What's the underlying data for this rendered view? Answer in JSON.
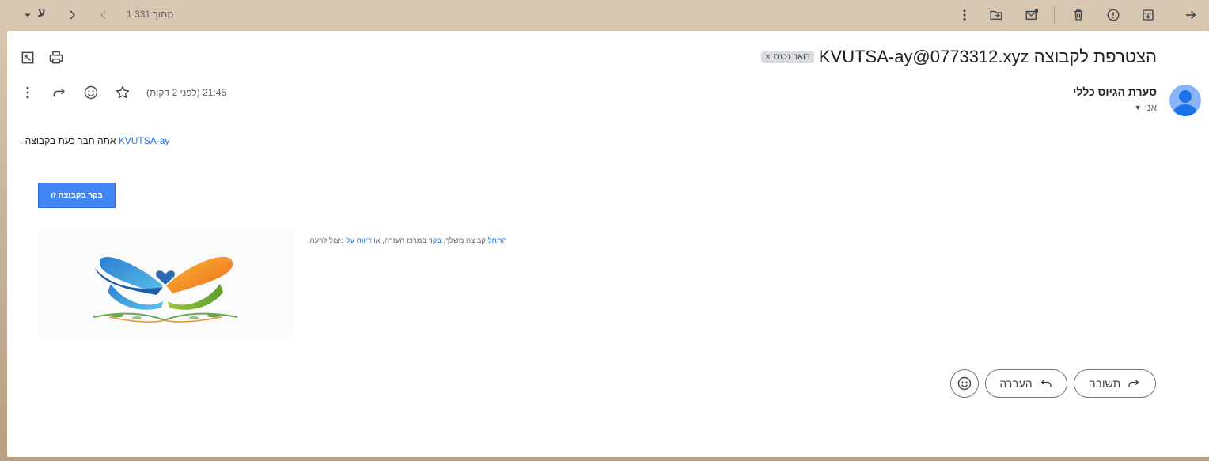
{
  "toolbar": {
    "lang_letter": "ע",
    "pager_text": "1 מתוך 331"
  },
  "email": {
    "subject": "הצטרפת לקבוצה KVUTSA-ay@0773312.xyz",
    "label_chip": "דואר נכנס",
    "label_close": "×",
    "sender_name": "סערת הגיוס כללי",
    "recipient": "אני",
    "timestamp": "21:45 (לפני 2 דקות)",
    "body": {
      "group_link": "KVUTSA-ay",
      "member_text": " אתה חבר כעת בקבוצה",
      "trailing": " .",
      "visit_button": "בקר בקבוצה זו",
      "footer_start": "התחל",
      "footer_t1": " קבוצה משלך, ",
      "footer_visit": "בקר",
      "footer_t2": " במרכז העזרה, או ",
      "footer_report": "דיווח על",
      "footer_t3": " ניצול לרעה",
      "footer_dot": "."
    }
  },
  "actions": {
    "reply": "תשובה",
    "forward": "העברה"
  },
  "colors": {
    "accent": "#1a73e8",
    "button_blue": "#4285f4"
  }
}
